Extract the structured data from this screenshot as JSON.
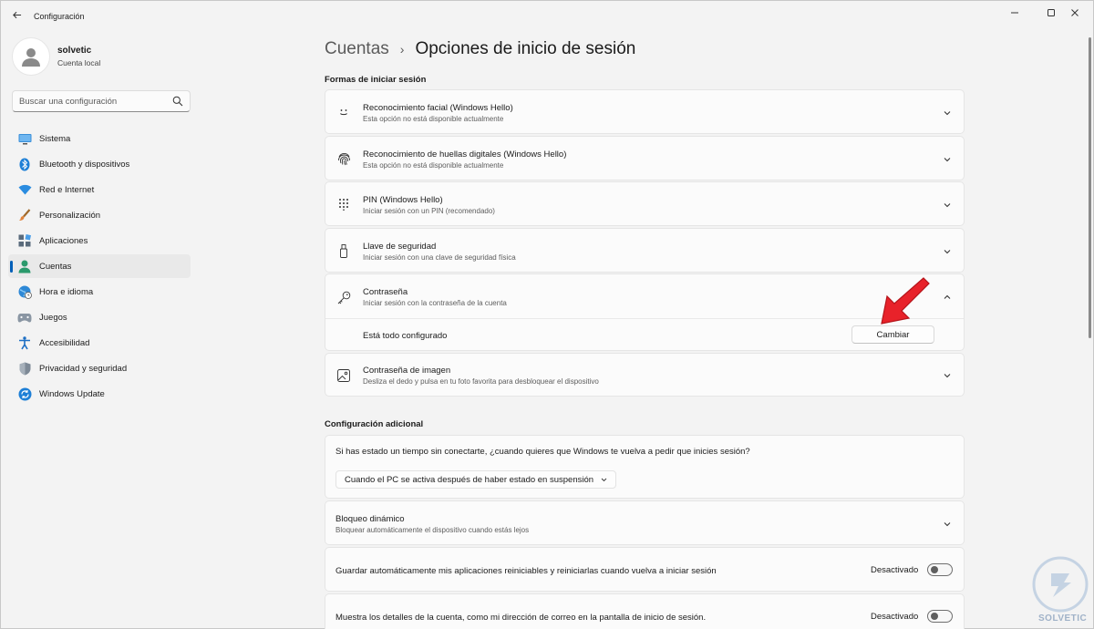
{
  "window": {
    "app_title": "Configuración",
    "controls": {
      "minimize": "—",
      "maximize": "☐",
      "close": "✕"
    }
  },
  "profile": {
    "name": "solvetic",
    "account_type": "Cuenta local"
  },
  "search": {
    "placeholder": "Buscar una configuración"
  },
  "sidebar": {
    "items": [
      {
        "label": "Sistema",
        "icon": "monitor-icon"
      },
      {
        "label": "Bluetooth y dispositivos",
        "icon": "bluetooth-icon"
      },
      {
        "label": "Red e Internet",
        "icon": "wifi-icon"
      },
      {
        "label": "Personalización",
        "icon": "brush-icon"
      },
      {
        "label": "Aplicaciones",
        "icon": "apps-icon"
      },
      {
        "label": "Cuentas",
        "icon": "person-icon",
        "selected": true
      },
      {
        "label": "Hora e idioma",
        "icon": "globe-clock-icon"
      },
      {
        "label": "Juegos",
        "icon": "gamepad-icon"
      },
      {
        "label": "Accesibilidad",
        "icon": "accessibility-icon"
      },
      {
        "label": "Privacidad y seguridad",
        "icon": "shield-icon"
      },
      {
        "label": "Windows Update",
        "icon": "update-icon"
      }
    ]
  },
  "breadcrumb": {
    "parent": "Cuentas",
    "separator": "›",
    "current": "Opciones de inicio de sesión"
  },
  "sign_in_section": {
    "title": "Formas de iniciar sesión",
    "options": [
      {
        "title": "Reconocimiento facial (Windows Hello)",
        "subtitle": "Esta opción no está disponible actualmente",
        "icon": "face-icon"
      },
      {
        "title": "Reconocimiento de huellas digitales (Windows Hello)",
        "subtitle": "Esta opción no está disponible actualmente",
        "icon": "fingerprint-icon"
      },
      {
        "title": "PIN (Windows Hello)",
        "subtitle": "Iniciar sesión con un PIN (recomendado)",
        "icon": "keypad-icon"
      },
      {
        "title": "Llave de seguridad",
        "subtitle": "Iniciar sesión con una clave de seguridad física",
        "icon": "usb-key-icon"
      },
      {
        "title": "Contraseña",
        "subtitle": "Iniciar sesión con la contraseña de la cuenta",
        "icon": "key-icon",
        "expanded": true
      },
      {
        "title": "Contraseña de imagen",
        "subtitle": "Desliza el dedo y pulsa en tu foto favorita para desbloquear el dispositivo",
        "icon": "image-icon"
      }
    ],
    "password_detail": {
      "status": "Está todo configurado",
      "button": "Cambiar"
    }
  },
  "additional_section": {
    "title": "Configuración adicional",
    "require_signin": {
      "question": "Si has estado un tiempo sin conectarte, ¿cuando quieres que Windows te vuelva a pedir que inicies sesión?",
      "selected_option": "Cuando el PC se activa después de haber estado en suspensión"
    },
    "dynamic_lock": {
      "title": "Bloqueo dinámico",
      "subtitle": "Bloquear automáticamente el dispositivo cuando estás lejos"
    },
    "restart_apps": {
      "title": "Guardar automáticamente mis aplicaciones reiniciables y reiniciarlas cuando vuelva a iniciar sesión",
      "state": "Desactivado"
    },
    "account_details": {
      "title": "Muestra los detalles de la cuenta, como mi dirección de correo en la pantalla de inicio de sesión.",
      "state": "Desactivado"
    }
  },
  "annotation": {
    "arrow_color": "#e8222a"
  },
  "watermark": {
    "text": "SOLVETIC"
  },
  "colors": {
    "accent": "#005fb8",
    "background": "#f3f3f3",
    "card": "#fbfbfb"
  }
}
